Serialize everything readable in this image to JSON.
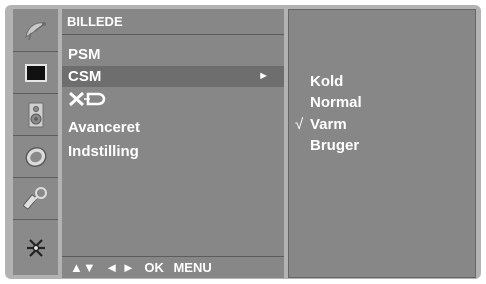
{
  "rail": {
    "icons": [
      {
        "name": "satellite-dish-icon"
      },
      {
        "name": "picture-screen-icon"
      },
      {
        "name": "speaker-icon"
      },
      {
        "name": "clock-icon"
      },
      {
        "name": "key-lock-icon"
      },
      {
        "name": "settings-connector-icon"
      }
    ],
    "selected_index": 1
  },
  "menu": {
    "title": "BILLEDE",
    "items": [
      {
        "label": "PSM"
      },
      {
        "label": "CSM",
        "arrow": "►"
      },
      {
        "label": "XD",
        "logo": true
      },
      {
        "label": "Avanceret"
      },
      {
        "label": "Indstilling"
      }
    ],
    "selected_index": 1
  },
  "footer": {
    "updown": "▲▼",
    "leftright": "◄ ►",
    "ok": "OK",
    "menu": "MENU"
  },
  "submenu": {
    "check": "√",
    "options": [
      {
        "label": "Kold"
      },
      {
        "label": "Normal"
      },
      {
        "label": "Varm",
        "checked": true
      },
      {
        "label": "Bruger"
      }
    ]
  },
  "colors": {
    "osd_bg": "#b3b3b3",
    "panel_bg": "#878787",
    "selected_row": "#6e6e6e",
    "text": "#ffffff"
  }
}
